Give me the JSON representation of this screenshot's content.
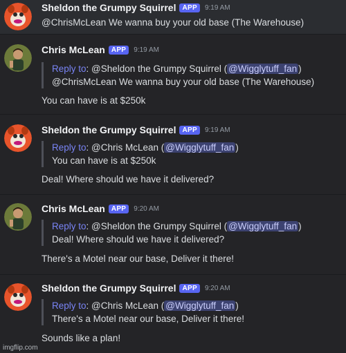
{
  "messages": [
    {
      "author": "Sheldon the Grumpy Squirrel",
      "badge": "APP",
      "time": "9:19 AM",
      "avatar_icon": "squirrel-avatar",
      "body": "@ChrisMcLean We wanna buy your old base (The Warehouse)"
    },
    {
      "author": "Chris McLean",
      "badge": "APP",
      "time": "9:19 AM",
      "avatar_icon": "chris-avatar",
      "reply": {
        "reply_to_label": "Reply to",
        "target": ": @Sheldon the Grumpy Squirrel (",
        "mention": "@Wigglytuff_fan",
        "close": ")",
        "quote": "@ChrisMcLean We wanna buy your old base (The Warehouse)"
      },
      "body": "You can have is at $250k"
    },
    {
      "author": "Sheldon the Grumpy Squirrel",
      "badge": "APP",
      "time": "9:19 AM",
      "avatar_icon": "squirrel-avatar",
      "reply": {
        "reply_to_label": "Reply to",
        "target": ": @Chris McLean (",
        "mention": "@Wigglytuff_fan",
        "close": ")",
        "quote": "You can have is at $250k"
      },
      "body": "Deal! Where should we have it delivered?"
    },
    {
      "author": "Chris McLean",
      "badge": "APP",
      "time": "9:20 AM",
      "avatar_icon": "chris-avatar",
      "reply": {
        "reply_to_label": "Reply to",
        "target": ": @Sheldon the Grumpy Squirrel (",
        "mention": "@Wigglytuff_fan",
        "close": ")",
        "quote": "Deal! Where should we have it delivered?"
      },
      "body": "There's a Motel near our base, Deliver it there!"
    },
    {
      "author": "Sheldon the Grumpy Squirrel",
      "badge": "APP",
      "time": "9:20 AM",
      "avatar_icon": "squirrel-avatar",
      "reply": {
        "reply_to_label": "Reply to",
        "target": ": @Chris McLean (",
        "mention": "@Wigglytuff_fan",
        "close": ")",
        "quote": "There's a Motel near our base, Deliver it there!"
      },
      "body": "Sounds like a plan!"
    }
  ],
  "watermark": "imgflip.com",
  "colors": {
    "background": "#242427",
    "badge": "#5865f2",
    "reply_link": "#7984f5",
    "mention_bg": "#3c4270"
  }
}
